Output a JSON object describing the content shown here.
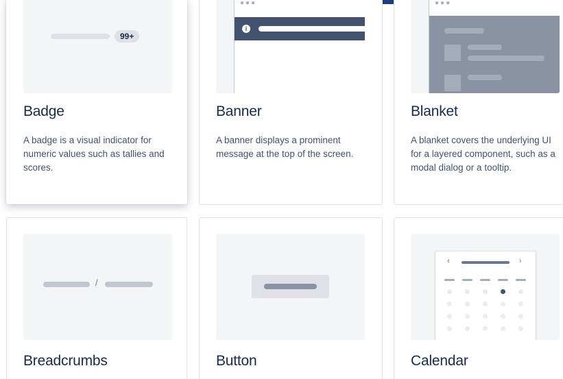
{
  "cards": [
    {
      "title": "Badge",
      "description": "A badge is a visual indicator for numeric values such as tallies and scores.",
      "illustration": {
        "badge_value": "99+"
      }
    },
    {
      "title": "Banner",
      "description": "A banner displays a prominent message at the top of the screen.",
      "illustration": {
        "icon": "info-icon",
        "glyph": "i",
        "window_controls": "●●●"
      }
    },
    {
      "title": "Blanket",
      "description": "A blanket covers the underlying UI for a layered component, such as a modal dialog or a tooltip.",
      "illustration": {
        "window_controls": "●●●"
      }
    },
    {
      "title": "Breadcrumbs",
      "description": "",
      "illustration": {
        "separator": "/"
      }
    },
    {
      "title": "Button",
      "description": "",
      "illustration": {}
    },
    {
      "title": "Calendar",
      "description": "",
      "illustration": {
        "prev": "‹",
        "next": "›",
        "selected_day_row": 1,
        "selected_day_col": 3
      }
    }
  ],
  "colors": {
    "brand_navy": "#1d3d7a",
    "banner_dark": "#42526e",
    "blanket_overlay": "#8993a4",
    "text_primary": "#172b4d",
    "text_secondary": "#42526e"
  }
}
